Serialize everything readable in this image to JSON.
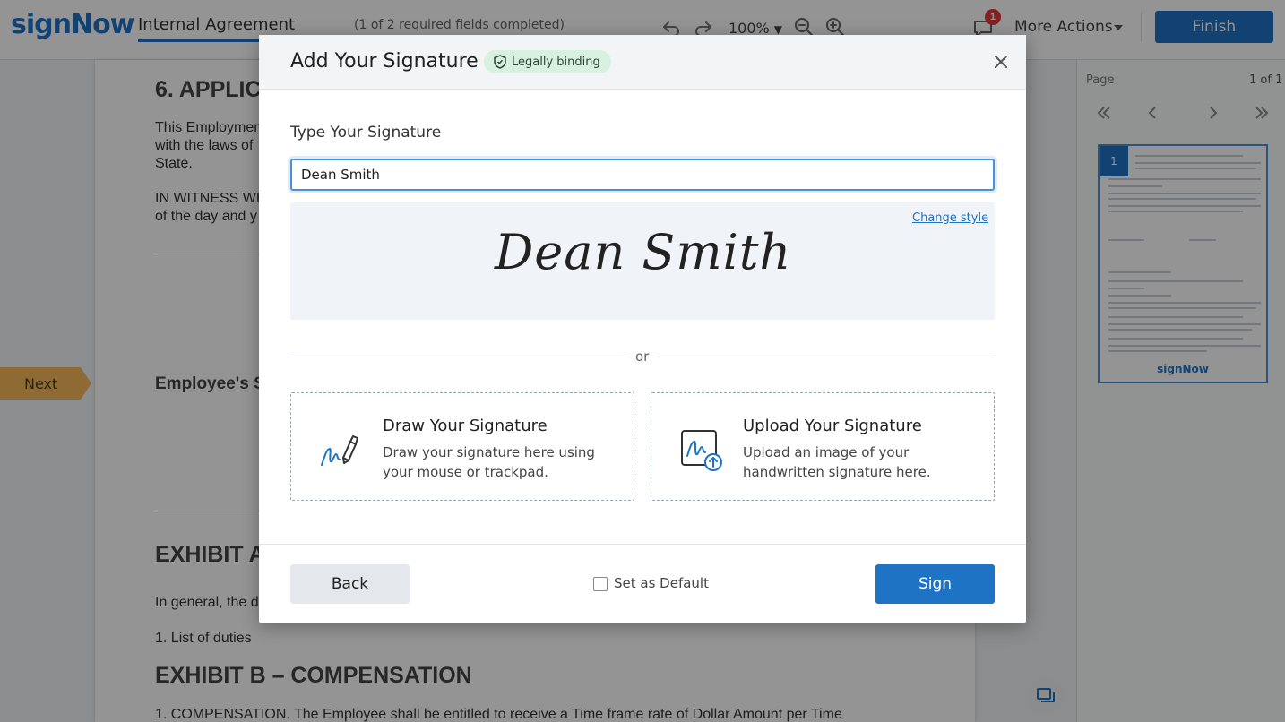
{
  "header": {
    "logo": "signNow",
    "doc_title": "Internal Agreement",
    "fields_status": "(1 of 2 required fields completed)",
    "zoom": "100%",
    "notification_count": "1",
    "more_actions": "More Actions",
    "finish_label": "Finish"
  },
  "document": {
    "section6_heading": "6. APPLICA",
    "section6_lines": [
      "This Employmen",
      "with the laws of",
      "State."
    ],
    "witness_lines": [
      "IN WITNESS WH",
      "of the day and y"
    ],
    "employee_sig_label": "Employee's S",
    "exhibit_a_heading": "EXHIBIT A",
    "exhibit_a_text": "In general, the d",
    "duties_item": "1. List of duties",
    "exhibit_b_heading": "EXHIBIT B – COMPENSATION",
    "compensation_text": "1. COMPENSATION. The Employee shall be entitled to receive a Time frame rate of Dollar Amount per Time"
  },
  "next_tag": "Next",
  "right_pane": {
    "page_label": "Page",
    "page_count": "1 of 1",
    "thumb_page_number": "1",
    "thumb_logo": "signNow"
  },
  "modal": {
    "title": "Add Your Signature",
    "badge": "Legally binding",
    "type_label": "Type Your Signature",
    "input_value": "Dean Smith",
    "change_style": "Change style",
    "preview_text": "Dean Smith",
    "or_text": "or",
    "draw_title": "Draw Your Signature",
    "draw_desc": "Draw your signature here using your mouse or trackpad.",
    "upload_title": "Upload Your Signature",
    "upload_desc": "Upload an image of your handwritten signature here.",
    "back_label": "Back",
    "default_label": "Set as Default",
    "sign_label": "Sign"
  },
  "colors": {
    "brand_blue": "#1e73c4",
    "badge_green": "#d7f0df",
    "next_tag": "#f4b85a",
    "notification_red": "#e03a3a"
  },
  "icons": [
    "undo-icon",
    "redo-icon",
    "zoom-out-icon",
    "zoom-in-icon",
    "chat-icon",
    "close-icon",
    "shield-check-icon",
    "pen-signature-icon",
    "upload-signature-icon",
    "first-page-icon",
    "prev-page-icon",
    "next-page-icon",
    "last-page-icon",
    "comment-icon"
  ]
}
